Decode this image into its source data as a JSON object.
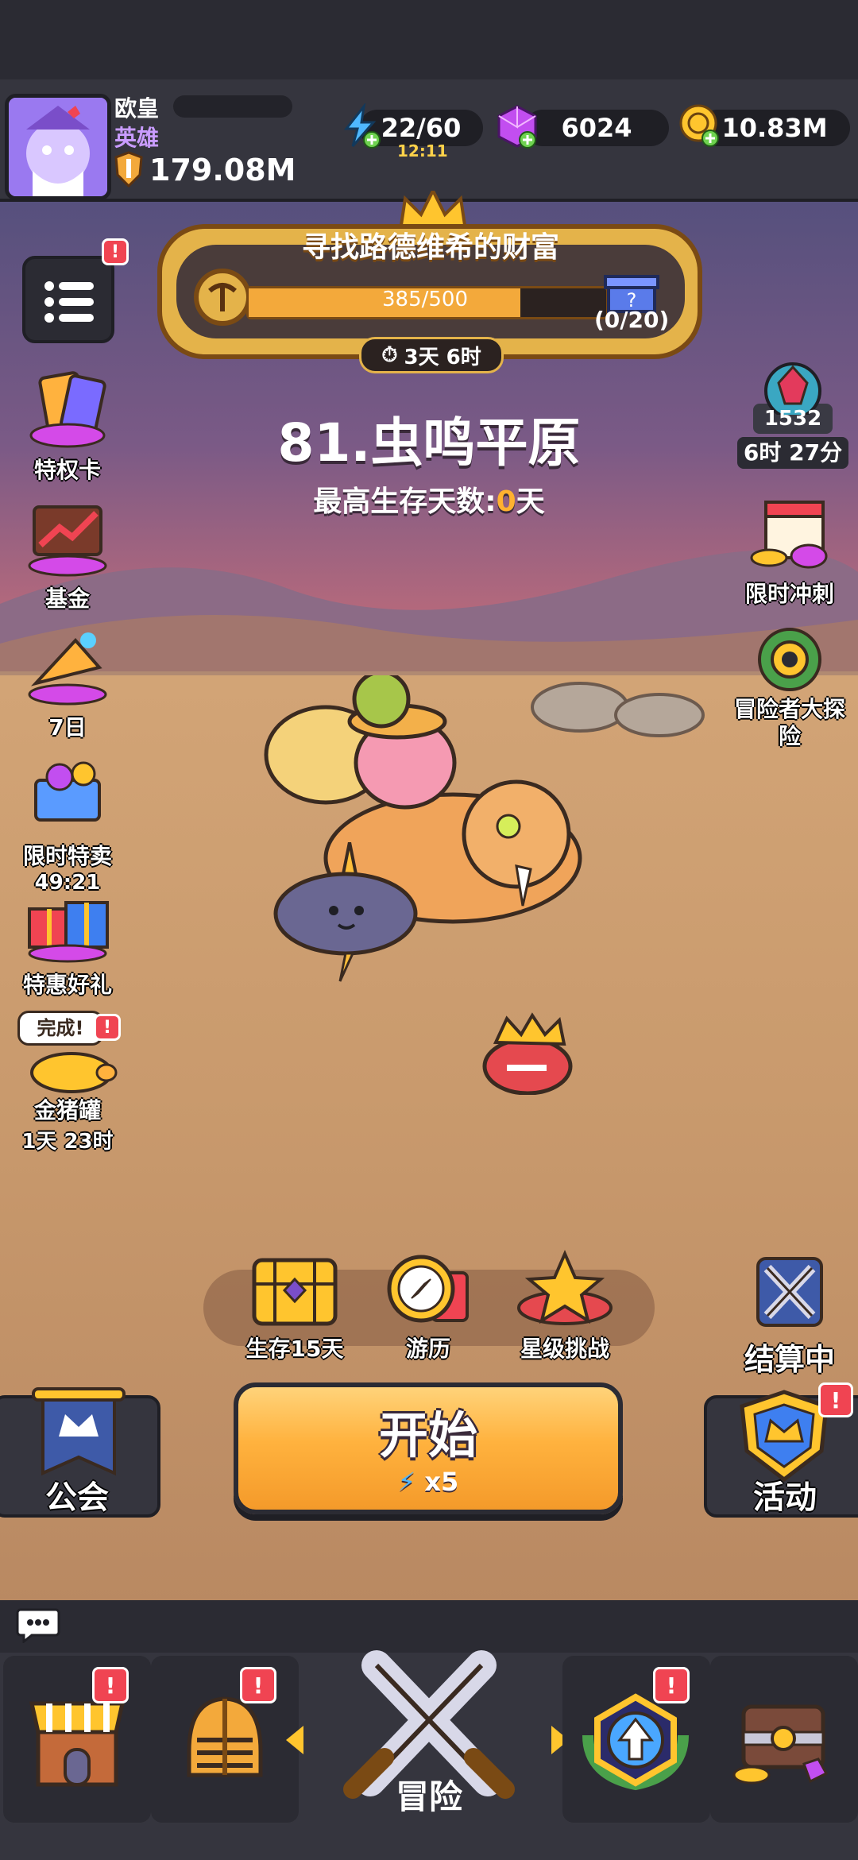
{
  "player": {
    "name": "欧皇",
    "rank": "英雄",
    "power": "179.08M"
  },
  "resources": {
    "energy": "22/60",
    "energy_timer": "12:11",
    "gems": "6024",
    "coins": "10.83M"
  },
  "event": {
    "title": "寻找路德维希的财富",
    "progress_text": "385/500",
    "progress_fraction": 0.77,
    "gift_count": "(0/20)",
    "timer": "3天 6时"
  },
  "stage": {
    "title": "81.虫鸣平原",
    "survival_prefix": "最高生存天数:",
    "survival_value": "0",
    "survival_suffix": "天"
  },
  "left_menu": {
    "badge": "!",
    "items": [
      {
        "label": "特权卡",
        "icon": "privilege-card-icon"
      },
      {
        "label": "基金",
        "icon": "fund-icon"
      },
      {
        "label": "7日",
        "icon": "seven-day-icon"
      },
      {
        "label": "限时特卖",
        "sub": "49:21",
        "icon": "flash-sale-icon"
      },
      {
        "label": "特惠好礼",
        "icon": "gift-pack-icon"
      },
      {
        "label": "金猪罐",
        "sub": "1天 23时",
        "bubble": "完成!",
        "icon": "piggy-bank-icon"
      }
    ]
  },
  "right_menu": {
    "crystal_value": "1532",
    "crystal_timer": "6时 27分",
    "sprint_label": "限时冲刺",
    "explore_label": "冒险者大探险",
    "settle_label": "结算中"
  },
  "features": [
    {
      "label": "生存15天",
      "icon": "chest-icon"
    },
    {
      "label": "游历",
      "icon": "compass-icon"
    },
    {
      "label": "星级挑战",
      "icon": "star-challenge-icon"
    }
  ],
  "buttons": {
    "guild": "公会",
    "start": "开始",
    "start_cost": "x5",
    "activity": "活动"
  },
  "nav": {
    "center_label": "冒险"
  }
}
